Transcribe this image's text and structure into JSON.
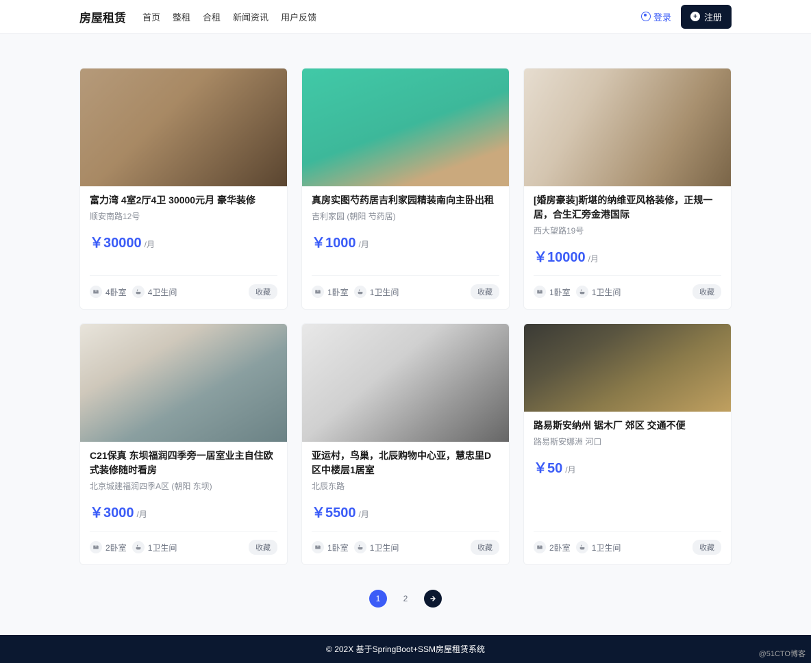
{
  "header": {
    "logo": "房屋租赁",
    "nav": [
      "首页",
      "整租",
      "合租",
      "新闻资讯",
      "用户反馈"
    ],
    "login": "登录",
    "signup": "注册"
  },
  "listings": [
    {
      "title": "富力湾 4室2厅4卫 30000元月 豪华装修",
      "location": "顺安南路12号",
      "price": "￥30000",
      "unit": "/月",
      "bedrooms": "4卧室",
      "bathrooms": "4卫生间",
      "fav": "收藏",
      "img": "img-1"
    },
    {
      "title": "真房实图芍药居吉利家园精装南向主卧出租",
      "location": "吉利家园 (朝阳 芍药居)",
      "price": "￥1000",
      "unit": "/月",
      "bedrooms": "1卧室",
      "bathrooms": "1卫生间",
      "fav": "收藏",
      "img": "img-2"
    },
    {
      "title": "[婚房豪装]斯堪的纳维亚风格装修，正规一居，合生汇旁金港国际",
      "location": "西大望路19号",
      "price": "￥10000",
      "unit": "/月",
      "bedrooms": "1卧室",
      "bathrooms": "1卫生间",
      "fav": "收藏",
      "img": "img-3"
    },
    {
      "title": "C21保真 东坝福润四季旁一居室业主自住欧式装修随时看房",
      "location": "北京城建福润四季A区 (朝阳 东坝)",
      "price": "￥3000",
      "unit": "/月",
      "bedrooms": "2卧室",
      "bathrooms": "1卫生间",
      "fav": "收藏",
      "img": "img-4"
    },
    {
      "title": "亚运村，鸟巢，北辰购物中心亚，慧忠里D区中楼层1居室",
      "location": "北辰东路",
      "price": "￥5500",
      "unit": "/月",
      "bedrooms": "1卧室",
      "bathrooms": "1卫生间",
      "fav": "收藏",
      "img": "img-5"
    },
    {
      "title": "路易斯安纳州 锯木厂 郊区 交通不便",
      "location": "路易斯安娜洲 河口",
      "price": "￥50",
      "unit": "/月",
      "bedrooms": "2卧室",
      "bathrooms": "1卫生间",
      "fav": "收藏",
      "img": "img-6"
    }
  ],
  "pagination": {
    "current": "1",
    "next_page": "2"
  },
  "footer": "© 202X 基于SpringBoot+SSM房屋租赁系统",
  "watermark": "@51CTO博客"
}
